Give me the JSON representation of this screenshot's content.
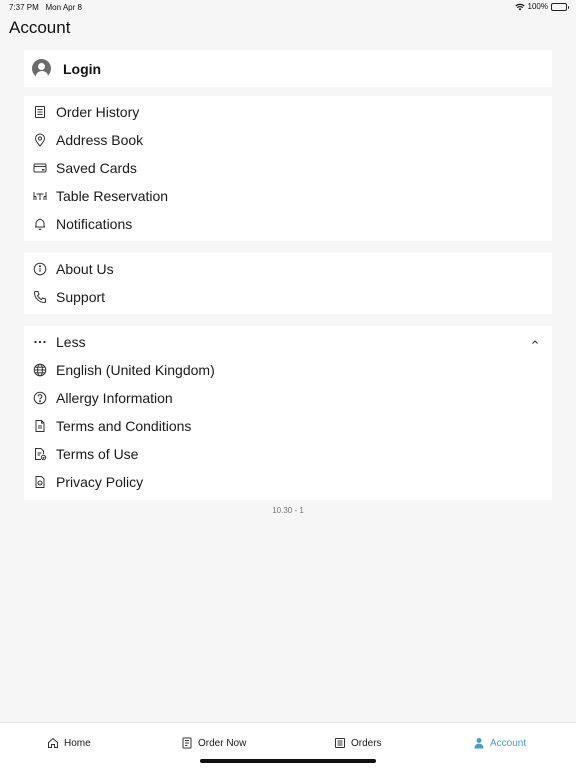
{
  "status_bar": {
    "time": "7:37 PM",
    "date": "Mon Apr 8",
    "battery": "100%"
  },
  "header": {
    "title": "Account"
  },
  "login": {
    "label": "Login",
    "icon": "user-avatar-icon"
  },
  "group1": [
    {
      "label": "Order History",
      "icon": "receipt-icon"
    },
    {
      "label": "Address Book",
      "icon": "location-pin-icon"
    },
    {
      "label": "Saved Cards",
      "icon": "credit-card-icon"
    },
    {
      "label": "Table Reservation",
      "icon": "table-chairs-icon"
    },
    {
      "label": "Notifications",
      "icon": "bell-icon"
    }
  ],
  "group2": [
    {
      "label": "About Us",
      "icon": "info-icon"
    },
    {
      "label": "Support",
      "icon": "phone-icon"
    }
  ],
  "group3": [
    {
      "label": "Less",
      "icon": "more-dots-icon"
    },
    {
      "label": "English (United Kingdom)",
      "icon": "globe-icon"
    },
    {
      "label": "Allergy Information",
      "icon": "help-circle-icon"
    },
    {
      "label": "Terms and Conditions",
      "icon": "document-icon"
    },
    {
      "label": "Terms of Use",
      "icon": "document-check-icon"
    },
    {
      "label": "Privacy Policy",
      "icon": "privacy-icon"
    }
  ],
  "version": "10.30 - 1",
  "tabs": [
    {
      "label": "Home",
      "icon": "home-icon"
    },
    {
      "label": "Order Now",
      "icon": "order-menu-icon"
    },
    {
      "label": "Orders",
      "icon": "orders-list-icon"
    },
    {
      "label": "Account",
      "icon": "account-icon",
      "active": true
    }
  ],
  "colors": {
    "accent": "#4a9bc7",
    "background": "#f6f6f6",
    "card": "#ffffff"
  }
}
